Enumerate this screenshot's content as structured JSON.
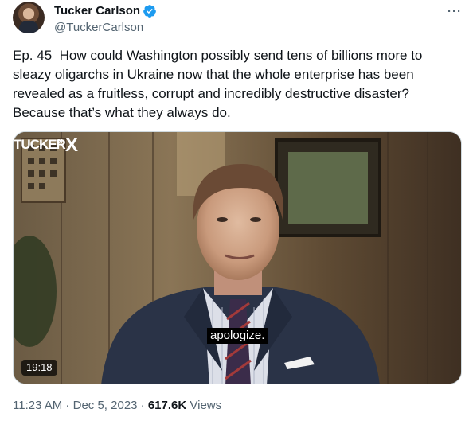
{
  "author": {
    "display_name": "Tucker Carlson",
    "handle": "@TuckerCarlson",
    "verified": true,
    "verified_color": "#1d9bf0"
  },
  "menu": {
    "more_label": "···"
  },
  "tweet": {
    "text": "Ep. 45  How could Washington possibly send tens of billions more to sleazy oligarchs in Ukraine now that the whole enterprise has been revealed as a fruitless, corrupt and incredibly destructive disaster? Because that’s what they always do."
  },
  "video": {
    "caption": "apologize.",
    "duration": "19:18",
    "brand_main": "TUCKER",
    "brand_on": "ON",
    "brand_x": "X"
  },
  "meta": {
    "time": "11:23 AM",
    "sep1": " · ",
    "date": "Dec 5, 2023",
    "sep2": " · ",
    "views_count": "617.6K",
    "views_label": " Views"
  }
}
